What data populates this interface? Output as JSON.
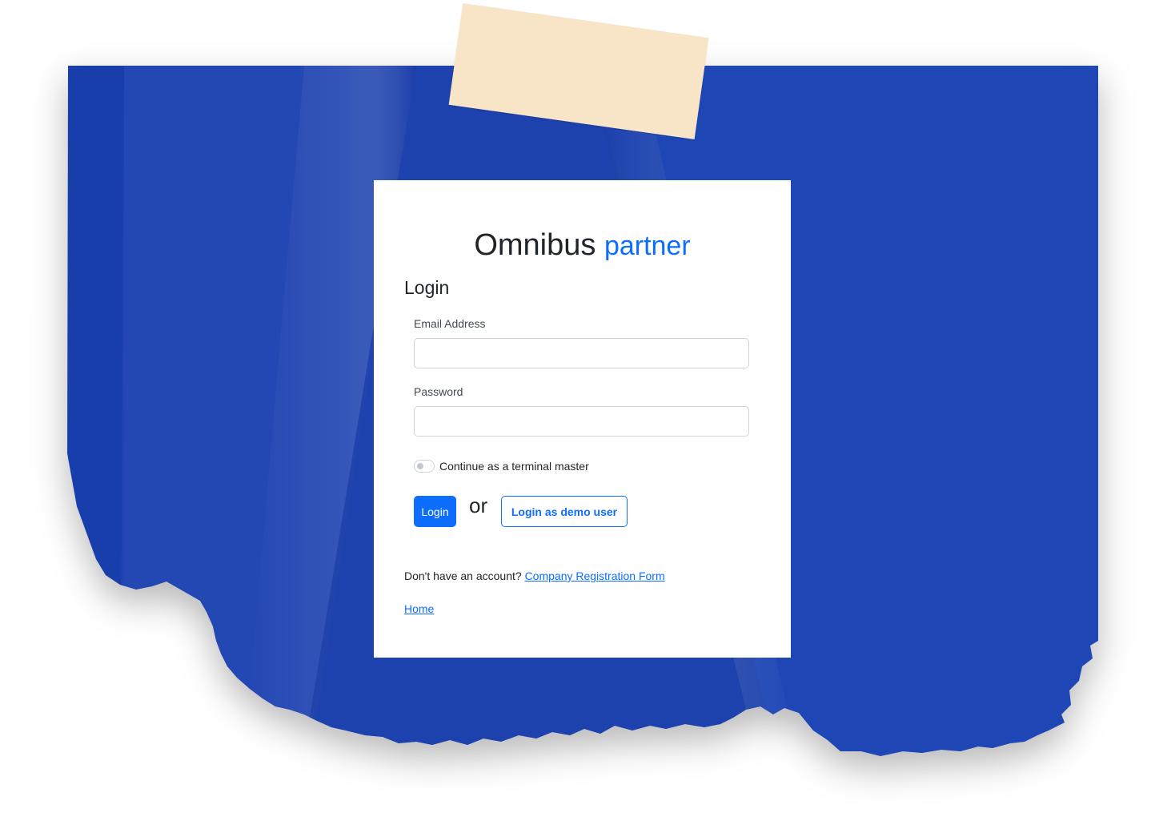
{
  "brand": {
    "name": "Omnibus",
    "accent": "partner"
  },
  "login": {
    "heading": "Login",
    "email_label": "Email Address",
    "email_value": "",
    "password_label": "Password",
    "password_value": "",
    "switch_label": "Continue as a terminal master",
    "switch_on": false,
    "login_button": "Login",
    "or_text": "or",
    "demo_button": "Login as demo user",
    "account_prompt": "Don't have an account?",
    "registration_link": "Company Registration Form",
    "home_link": "Home"
  },
  "colors": {
    "background_blue": "#1f44b5",
    "primary": "#0d6efd",
    "tape": "#f8e4c6"
  }
}
